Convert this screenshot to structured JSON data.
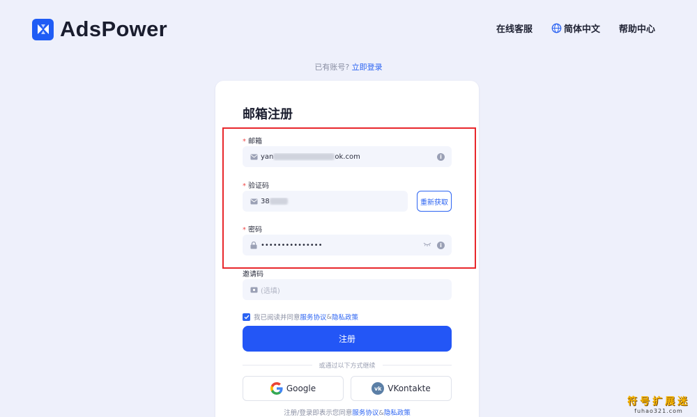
{
  "header": {
    "brand": "AdsPower",
    "nav": {
      "support": "在线客服",
      "language": "简体中文",
      "help": "帮助中心"
    }
  },
  "login_hint": {
    "text": "已有账号?",
    "link": "立即登录"
  },
  "form": {
    "title": "邮箱注册",
    "required_mark": "*",
    "email": {
      "label": "邮箱",
      "value_start": "yan",
      "value_end": "ok.com"
    },
    "code": {
      "label": "验证码",
      "value_start": "38",
      "resend": "重新获取"
    },
    "password": {
      "label": "密码",
      "value": "•••••••••••••••"
    },
    "invite": {
      "label": "邀请码",
      "placeholder": "(选填)"
    },
    "agreement": {
      "prefix": "我已阅读并同意",
      "service": "服务协议",
      "amp": "&",
      "privacy": "隐私政策"
    },
    "submit": "注册",
    "divider": "或通过以下方式继续",
    "social": {
      "google": "Google",
      "vk": "VKontakte"
    },
    "terms": {
      "prefix": "注册/登录即表示您同意",
      "service": "服务协议",
      "amp": "&",
      "privacy": "隐私政策"
    }
  },
  "watermark": {
    "cn": "符号扩展迷",
    "en": "fuhao321.com"
  },
  "colors": {
    "accent": "#2356f6",
    "background": "#eef0fb",
    "highlight_box": "#e8262b",
    "required": "#f04848"
  },
  "icons": [
    "adspower-logo-icon",
    "globe-icon",
    "mail-icon",
    "lock-icon",
    "info-icon",
    "eye-closed-icon",
    "ticket-icon",
    "check-icon",
    "google-icon",
    "vk-icon"
  ]
}
